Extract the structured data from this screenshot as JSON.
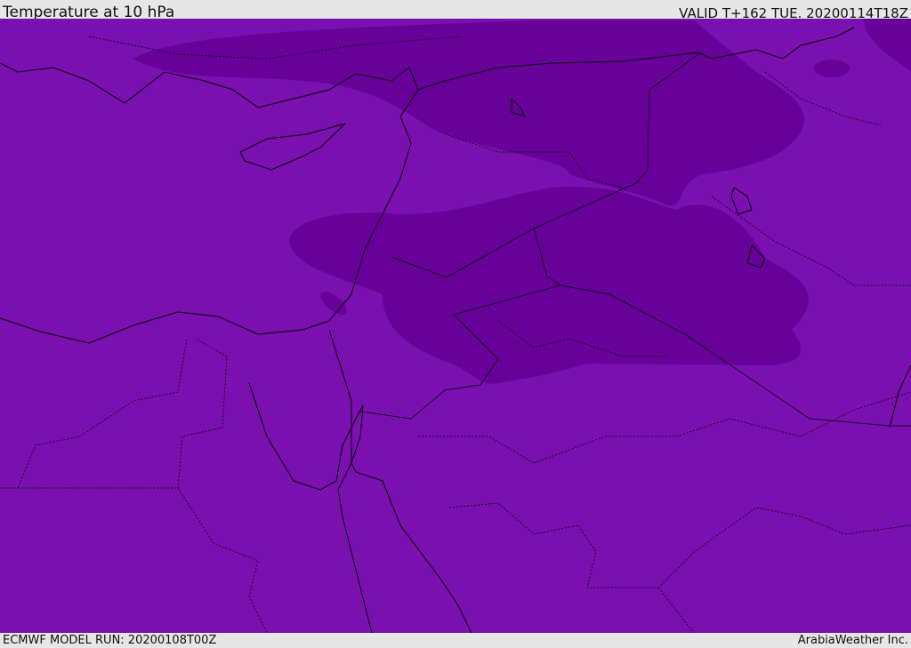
{
  "header": {
    "title": "Temperature at 10 hPa",
    "valid": "VALID T+162 TUE. 20200114T18Z"
  },
  "footer": {
    "model_run": "ECMWF MODEL RUN: 20200108T00Z",
    "credit": "ArabiaWeather Inc."
  },
  "colors": {
    "base_shade": "#7a10b0",
    "cold_shade": "#68009a",
    "coast": "#000000"
  }
}
